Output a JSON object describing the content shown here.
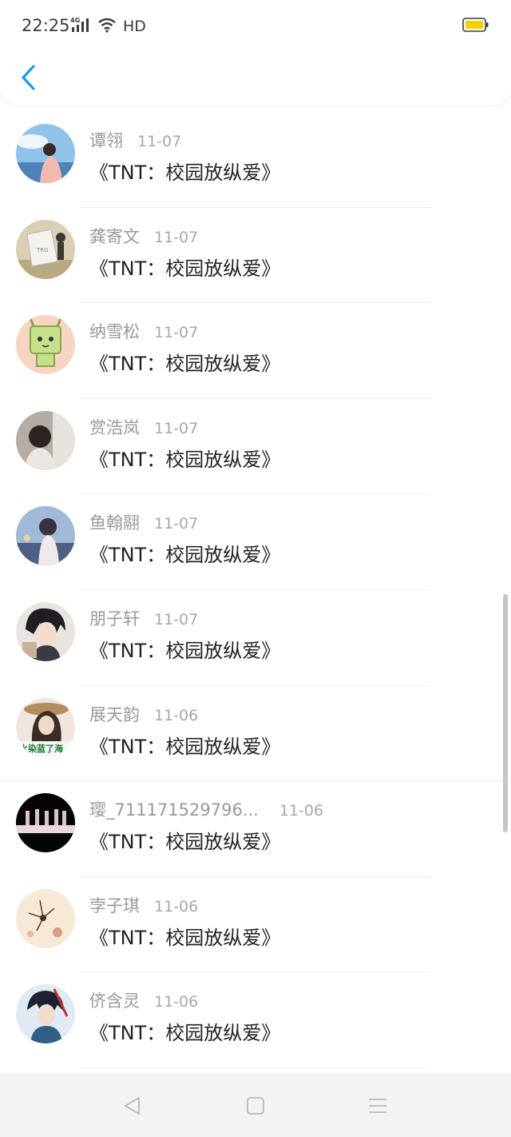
{
  "status": {
    "time": "22:25",
    "network": "4G",
    "hd": "HD",
    "battery_color": "#f5d000"
  },
  "header": {
    "back_icon": "chevron-left-icon",
    "accent_color": "#1a9cf0"
  },
  "messages": [
    {
      "name": "谭翎",
      "date": "11-07",
      "text": "《TNT：校园放纵爱》"
    },
    {
      "name": "龚寄文",
      "date": "11-07",
      "text": "《TNT：校园放纵爱》"
    },
    {
      "name": "纳雪松",
      "date": "11-07",
      "text": "《TNT：校园放纵爱》"
    },
    {
      "name": "赏浩岚",
      "date": "11-07",
      "text": "《TNT：校园放纵爱》"
    },
    {
      "name": "鱼翰翮",
      "date": "11-07",
      "text": "《TNT：校园放纵爱》"
    },
    {
      "name": "朋子轩",
      "date": "11-07",
      "text": "《TNT：校园放纵爱》"
    },
    {
      "name": "展天韵",
      "date": "11-06",
      "text": "《TNT：校园放纵爱》",
      "avatar_caption": "水染蓝了海"
    },
    {
      "name": "璎_711171529796...",
      "date": "11-06",
      "text": "《TNT：校园放纵爱》"
    },
    {
      "name": "孛子琪",
      "date": "11-06",
      "text": "《TNT：校园放纵爱》"
    },
    {
      "name": "侪含灵",
      "date": "11-06",
      "text": "《TNT：校园放纵爱》"
    }
  ],
  "navbar": {
    "icons": [
      "back-triangle-icon",
      "home-square-icon",
      "menu-lines-icon"
    ]
  }
}
